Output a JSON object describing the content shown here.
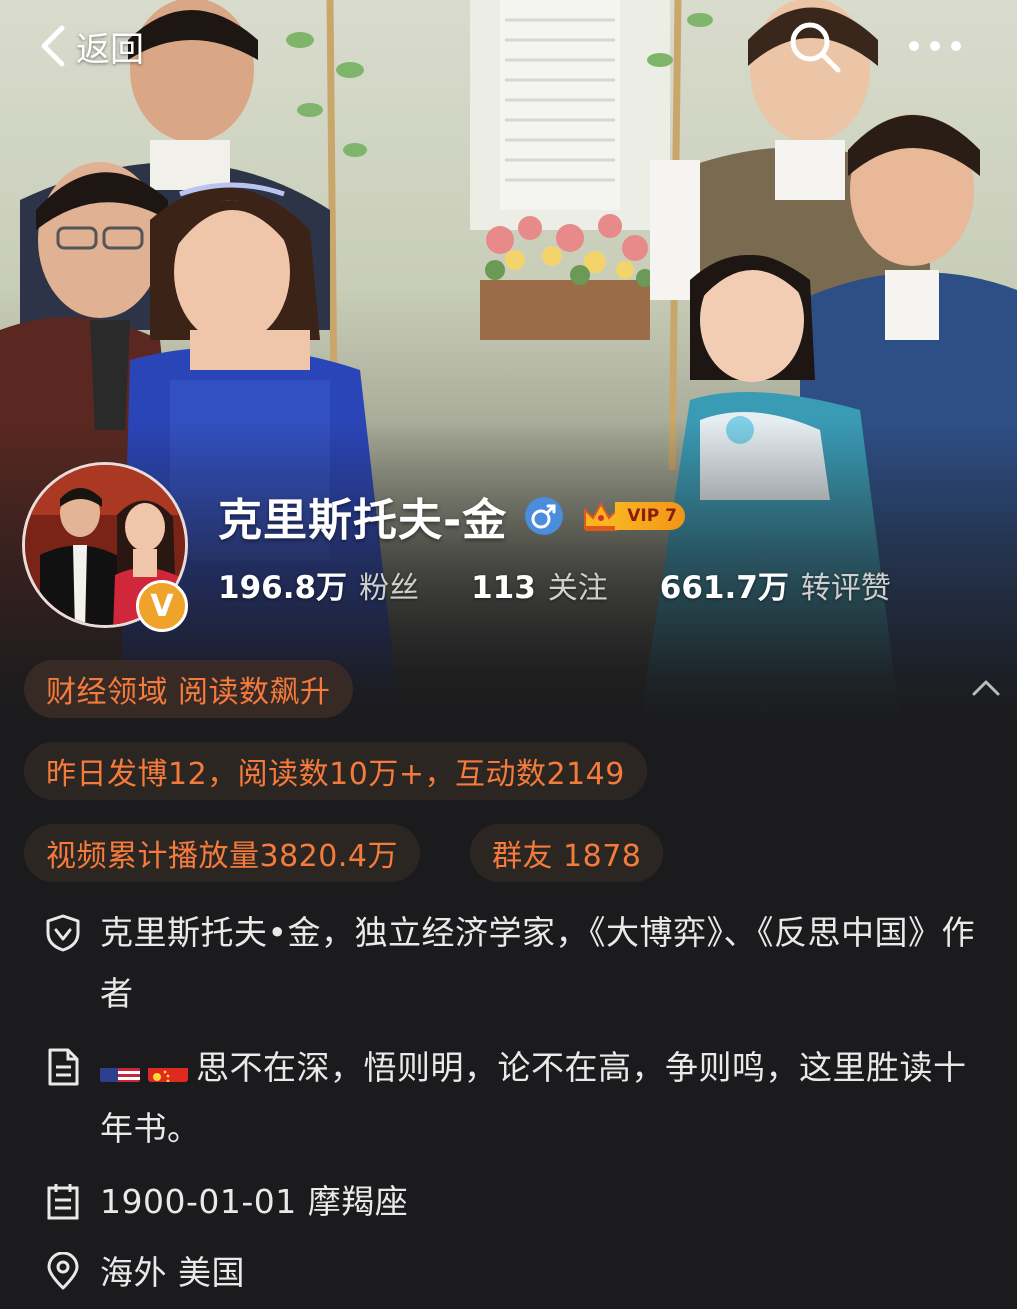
{
  "topbar": {
    "back_label": "返回",
    "search_icon": "search-icon",
    "more_icon": "more-icon"
  },
  "profile": {
    "name": "克里斯托夫-金",
    "gender": "♂",
    "vip_label": "VIP 7",
    "verified_badge": "V",
    "stats": [
      {
        "value": "196.8万",
        "label": "粉丝"
      },
      {
        "value": "113",
        "label": "关注"
      },
      {
        "value": "661.7万",
        "label": "转评赞"
      }
    ]
  },
  "chips": {
    "domain": "财经领域 阅读数飙升",
    "yesterday": "昨日发博12，阅读数10万+，互动数2149",
    "video": "视频累计播放量3820.4万",
    "fans_group": "群友 1878"
  },
  "info": {
    "verify_text": "克里斯托夫•金，独立经济学家，《大博弈》、《反思中国》作者",
    "bio_flags": [
      "us-flag-icon",
      "cn-flag-icon"
    ],
    "bio_text": "思不在深，悟则明，论不在高，争则鸣，这里胜读十年书。",
    "birth_text": "1900-01-01 摩羯座",
    "location_text": "海外 美国"
  },
  "colors": {
    "background": "#1b1b1d",
    "accent_orange": "#f47b3c",
    "chip_bg": "#2b2622",
    "vip_gold": "#f7b520",
    "gender_blue": "#4a8ddc"
  }
}
